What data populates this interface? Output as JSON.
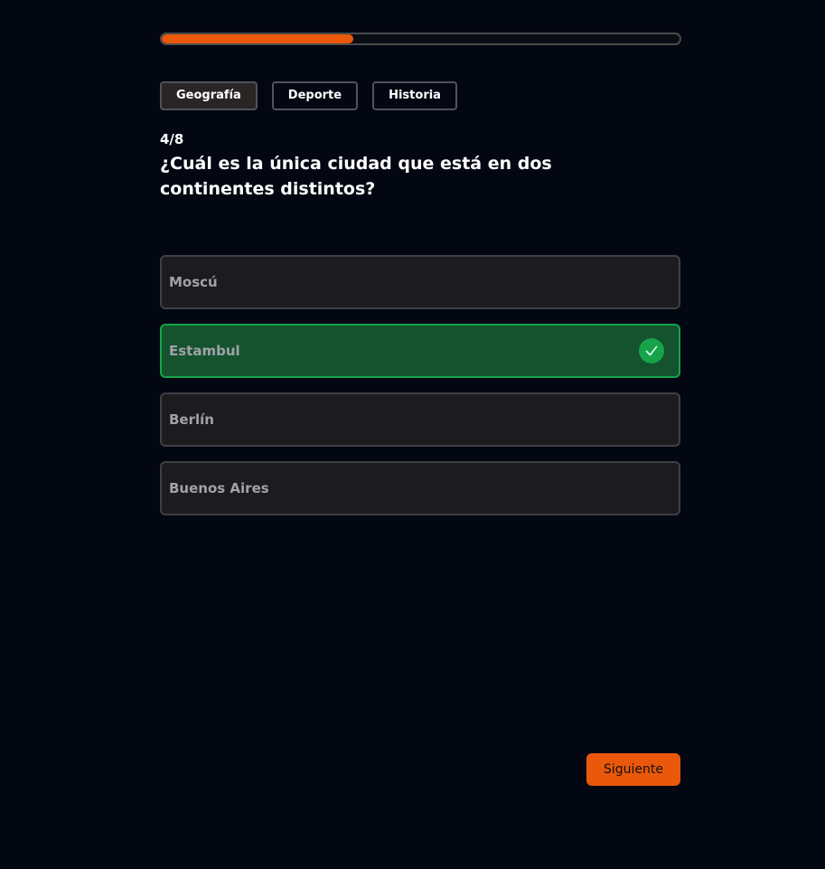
{
  "progress": {
    "fraction": 0.37
  },
  "tabs": [
    {
      "label": "Geografía",
      "active": true
    },
    {
      "label": "Deporte",
      "active": false
    },
    {
      "label": "Historia",
      "active": false
    }
  ],
  "quiz": {
    "counter": "4/8",
    "question": "¿Cuál es la única ciudad que está en dos continentes distintos?"
  },
  "options": [
    {
      "label": "Moscú",
      "state": "neutral"
    },
    {
      "label": "Estambul",
      "state": "correct",
      "icon": "check-circle-icon"
    },
    {
      "label": "Berlín",
      "state": "neutral"
    },
    {
      "label": "Buenos Aires",
      "state": "neutral"
    }
  ],
  "footer": {
    "next_label": "Siguiente"
  },
  "colors": {
    "accent": "#ea580c",
    "correct_bg": "#14532d",
    "correct_border": "#16a34a",
    "background": "#030712"
  }
}
